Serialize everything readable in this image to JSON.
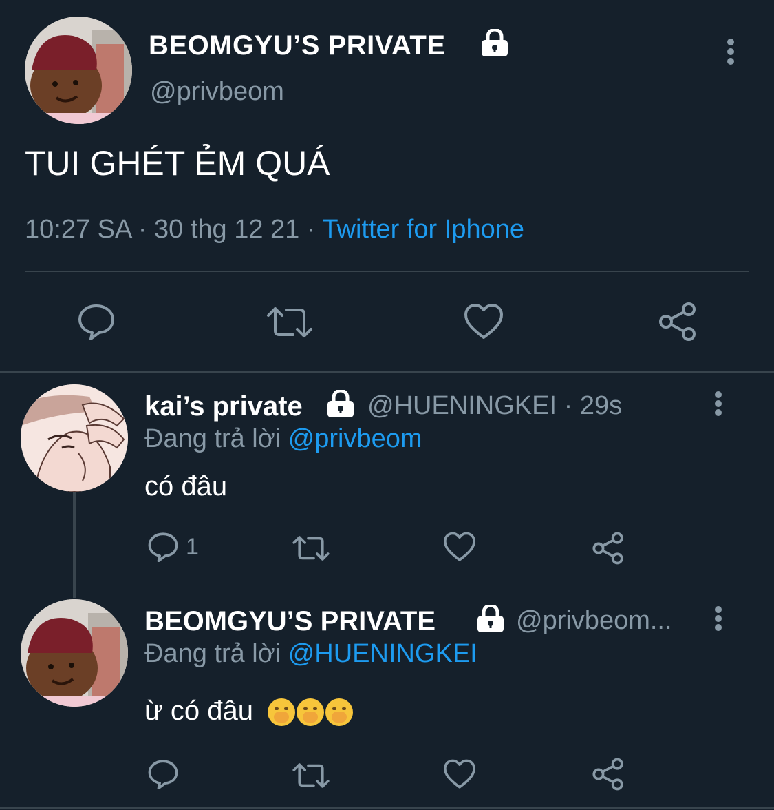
{
  "main_tweet": {
    "display_name": "BEOMGYU’S PRIVATE",
    "handle": "@privbeom",
    "text": "TUI GHÉT ẺM QUÁ",
    "time": "10:27 SA · 30 thg 12 21 ·",
    "source": "Twitter for Iphone"
  },
  "replies": [
    {
      "display_name": "kai’s private",
      "handle_time": "@HUENINGKEI · 29s",
      "replying_prefix": "Đang trả lời",
      "replying_to": "@privbeom",
      "text": "có đâu",
      "reply_count": "1"
    },
    {
      "display_name": "BEOMGYU’S PRIVATE",
      "handle_time": "@privbeom...",
      "replying_prefix": "Đang trả lời",
      "replying_to": "@HUENINGKEI",
      "text": "ừ có đâu",
      "emojis": [
        "face-with-hand-over-mouth",
        "face-with-hand-over-mouth",
        "face-with-hand-over-mouth"
      ]
    }
  ],
  "colors": {
    "background": "#15202b",
    "secondary_text": "#8899a6",
    "link": "#1d9bf0",
    "divider": "#38444d"
  }
}
